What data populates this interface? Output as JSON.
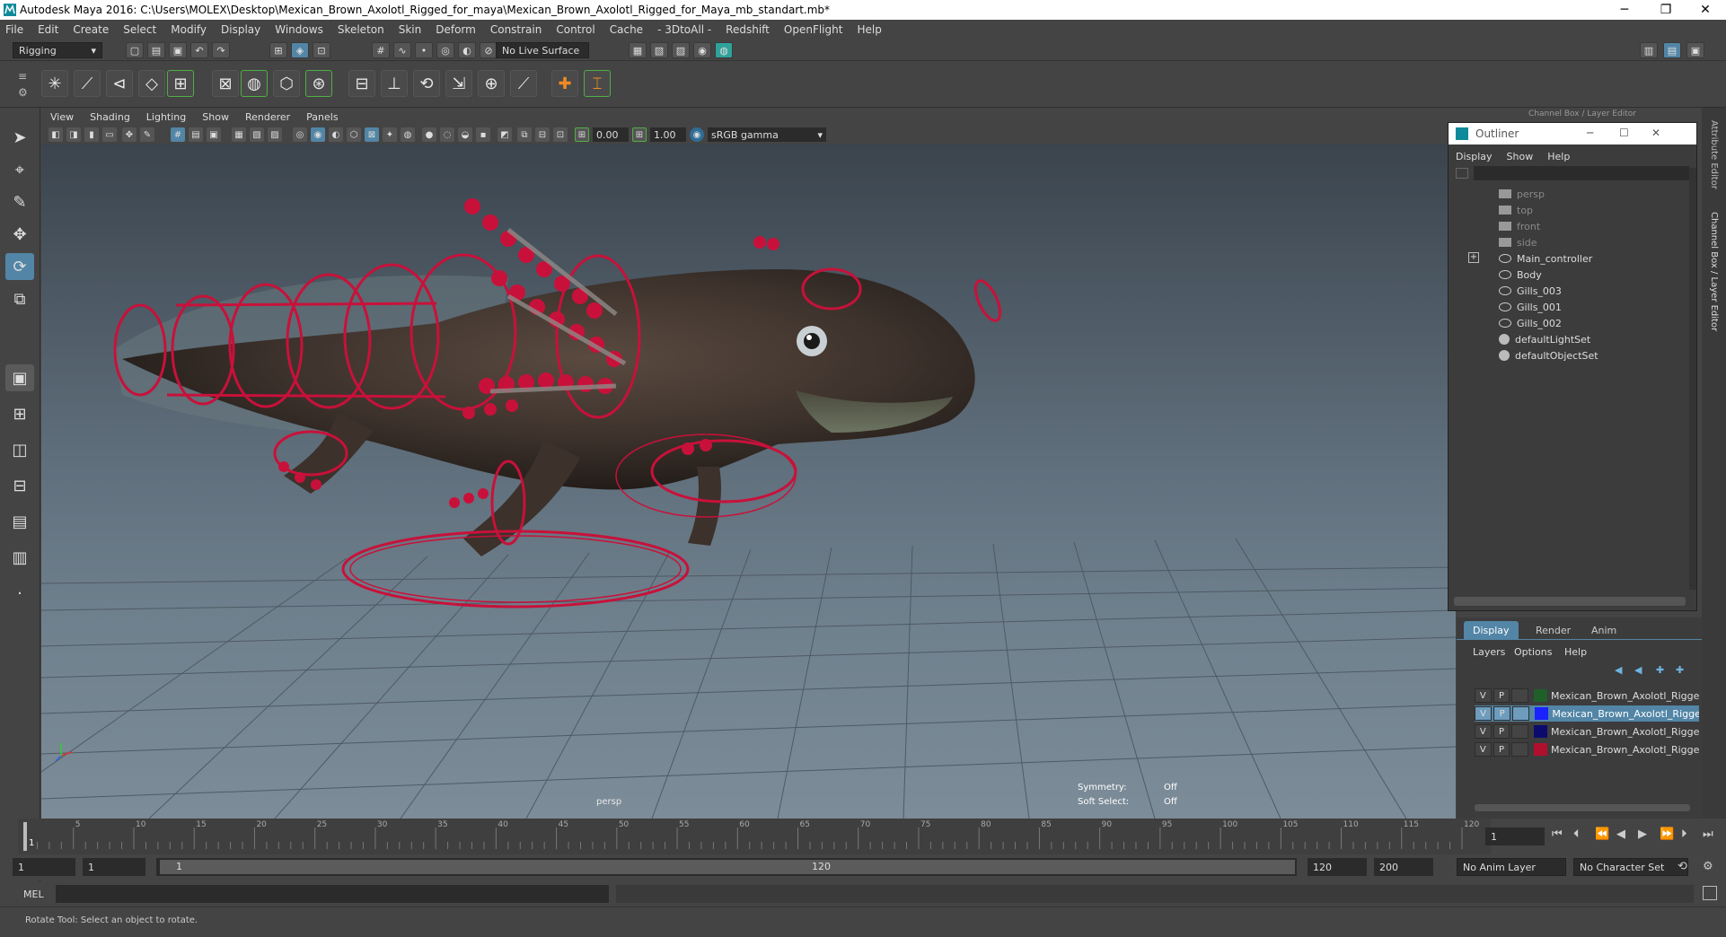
{
  "window": {
    "title": "Autodesk Maya 2016: C:\\Users\\MOLEX\\Desktop\\Mexican_Brown_Axolotl_Rigged_for_maya\\Mexican_Brown_Axolotl_Rigged_for_Maya_mb_standart.mb*",
    "minimize": "─",
    "restore": "❐",
    "close": "✕"
  },
  "menubar": [
    "File",
    "Edit",
    "Create",
    "Select",
    "Modify",
    "Display",
    "Windows",
    "Skeleton",
    "Skin",
    "Deform",
    "Constrain",
    "Control",
    "Cache",
    "- 3DtoAll -",
    "Redshift",
    "OpenFlight",
    "Help"
  ],
  "status": {
    "mode": "Rigging",
    "live_surface": "No Live Surface"
  },
  "viewport": {
    "menu": [
      "View",
      "Shading",
      "Lighting",
      "Show",
      "Renderer",
      "Panels"
    ],
    "exposure": "0.00",
    "gamma": "1.00",
    "color_space": "sRGB gamma",
    "camera_label": "persp",
    "symmetry_label": "Symmetry:",
    "symmetry_value": "Off",
    "soft_select_label": "Soft Select:",
    "soft_select_value": "Off"
  },
  "outliner": {
    "title": "Outliner",
    "menu": [
      "Display",
      "Show",
      "Help"
    ],
    "items": [
      {
        "label": "persp",
        "type": "camera",
        "dim": true
      },
      {
        "label": "top",
        "type": "camera",
        "dim": true
      },
      {
        "label": "front",
        "type": "camera",
        "dim": true
      },
      {
        "label": "side",
        "type": "camera",
        "dim": true
      },
      {
        "label": "Main_controller",
        "type": "transform",
        "expandable": true
      },
      {
        "label": "Body",
        "type": "transform"
      },
      {
        "label": "Gills_003",
        "type": "transform"
      },
      {
        "label": "Gills_001",
        "type": "transform"
      },
      {
        "label": "Gills_002",
        "type": "transform"
      },
      {
        "label": "defaultLightSet",
        "type": "set"
      },
      {
        "label": "defaultObjectSet",
        "type": "set"
      }
    ],
    "expand_symbol": "+"
  },
  "channel_box": {
    "title": "Channel Box / Layer Editor"
  },
  "side_tabs": [
    "Attribute Editor",
    "Channel Box / Layer Editor"
  ],
  "layer_editor": {
    "tabs": [
      "Display",
      "Render",
      "Anim"
    ],
    "active_tab": "Display",
    "menu": [
      "Layers",
      "Options",
      "Help"
    ],
    "layers": [
      {
        "v": "V",
        "p": "P",
        "color": "#1f5f2a",
        "name": "Mexican_Brown_Axolotl_Rigged_",
        "selected": false
      },
      {
        "v": "V",
        "p": "P",
        "color": "#1a22ff",
        "name": "Mexican_Brown_Axolotl_Rigged",
        "selected": true
      },
      {
        "v": "V",
        "p": "P",
        "color": "#0b0b6e",
        "name": "Mexican_Brown_Axolotl_Rigged_",
        "selected": false
      },
      {
        "v": "V",
        "p": "P",
        "color": "#b0102e",
        "name": "Mexican_Brown_Axolotl_Rigged_",
        "selected": false
      }
    ]
  },
  "timeline": {
    "ticks": [
      "5",
      "10",
      "15",
      "20",
      "25",
      "30",
      "35",
      "40",
      "45",
      "50",
      "55",
      "60",
      "65",
      "70",
      "75",
      "80",
      "85",
      "90",
      "95",
      "100",
      "105",
      "110",
      "115",
      "120"
    ],
    "current_frame": "1",
    "current_frame_field": "1",
    "range_start_outer": "1",
    "range_start_inner": "1",
    "range_slider_start": "1",
    "range_slider_end": "120",
    "range_end_inner": "120",
    "range_end_outer": "200",
    "anim_layer": "No Anim Layer",
    "character_set": "No Character Set"
  },
  "cmdline": {
    "label": "MEL"
  },
  "helpline": {
    "text": "Rotate Tool: Select an object to rotate."
  },
  "colors": {
    "accent": "#5285a6",
    "rig_red": "#c8113a",
    "ui_bg": "#444444"
  }
}
